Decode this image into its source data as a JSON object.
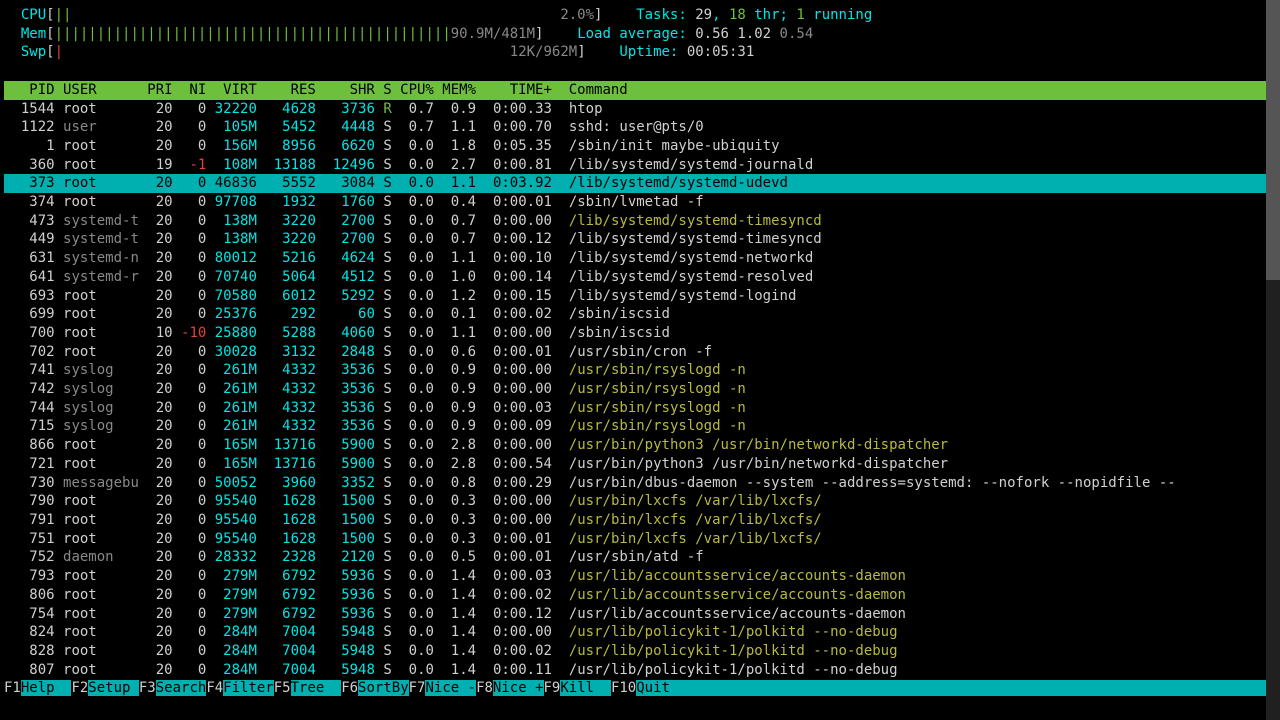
{
  "meters": {
    "cpu": {
      "label": "CPU",
      "bar": "||",
      "pct": "2.0%"
    },
    "mem": {
      "label": "Mem",
      "bar": "|||||||||||||||||||||||||||||||||||||||||||||||",
      "used": "90.9M/481M"
    },
    "swp": {
      "label": "Swp",
      "bar": "|",
      "used": "12K/962M"
    }
  },
  "summary": {
    "tasks_label": "Tasks:",
    "tasks": "29",
    "thr": "18",
    "thr_label": "thr;",
    "running": "1",
    "running_label": "running",
    "load_label": "Load average:",
    "la1": "0.56",
    "la5": "1.02",
    "la15": "0.54",
    "uptime_label": "Uptime:",
    "uptime": "00:05:31"
  },
  "headers": [
    "PID",
    "USER",
    "PRI",
    "NI",
    "VIRT",
    "RES",
    "SHR",
    "S",
    "CPU%",
    "MEM%",
    "TIME+",
    "Command"
  ],
  "processes": [
    {
      "pid": "1544",
      "user": "root",
      "pri": "20",
      "ni": "0",
      "virt": "32220",
      "res": "4628",
      "shr": "3736",
      "s": "R",
      "cpu": "0.7",
      "mem": "0.9",
      "time": "0:00.33",
      "cmd": "htop",
      "cmdhi": false
    },
    {
      "pid": "1122",
      "user": "user",
      "pri": "20",
      "ni": "0",
      "virt": "105M",
      "res": "5452",
      "shr": "4448",
      "s": "S",
      "cpu": "0.7",
      "mem": "1.1",
      "time": "0:00.70",
      "cmd": "sshd: user@pts/0",
      "cmdhi": false
    },
    {
      "pid": "1",
      "user": "root",
      "pri": "20",
      "ni": "0",
      "virt": "156M",
      "res": "8956",
      "shr": "6620",
      "s": "S",
      "cpu": "0.0",
      "mem": "1.8",
      "time": "0:05.35",
      "cmd": "/sbin/init maybe-ubiquity",
      "cmdhi": false
    },
    {
      "pid": "360",
      "user": "root",
      "pri": "19",
      "ni": "-1",
      "virt": "108M",
      "res": "13188",
      "shr": "12496",
      "s": "S",
      "cpu": "0.0",
      "mem": "2.7",
      "time": "0:00.81",
      "cmd": "/lib/systemd/systemd-journald",
      "cmdhi": false,
      "nineg": true
    },
    {
      "pid": "373",
      "user": "root",
      "pri": "20",
      "ni": "0",
      "virt": "46836",
      "res": "5552",
      "shr": "3084",
      "s": "S",
      "cpu": "0.0",
      "mem": "1.1",
      "time": "0:03.92",
      "cmd": "/lib/systemd/systemd-udevd",
      "cmdhi": false,
      "selected": true
    },
    {
      "pid": "374",
      "user": "root",
      "pri": "20",
      "ni": "0",
      "virt": "97708",
      "res": "1932",
      "shr": "1760",
      "s": "S",
      "cpu": "0.0",
      "mem": "0.4",
      "time": "0:00.01",
      "cmd": "/sbin/lvmetad -f",
      "cmdhi": false
    },
    {
      "pid": "473",
      "user": "systemd-t",
      "pri": "20",
      "ni": "0",
      "virt": "138M",
      "res": "3220",
      "shr": "2700",
      "s": "S",
      "cpu": "0.0",
      "mem": "0.7",
      "time": "0:00.00",
      "cmd": "/lib/systemd/systemd-timesyncd",
      "cmdhi": true
    },
    {
      "pid": "449",
      "user": "systemd-t",
      "pri": "20",
      "ni": "0",
      "virt": "138M",
      "res": "3220",
      "shr": "2700",
      "s": "S",
      "cpu": "0.0",
      "mem": "0.7",
      "time": "0:00.12",
      "cmd": "/lib/systemd/systemd-timesyncd",
      "cmdhi": false
    },
    {
      "pid": "631",
      "user": "systemd-n",
      "pri": "20",
      "ni": "0",
      "virt": "80012",
      "res": "5216",
      "shr": "4624",
      "s": "S",
      "cpu": "0.0",
      "mem": "1.1",
      "time": "0:00.10",
      "cmd": "/lib/systemd/systemd-networkd",
      "cmdhi": false
    },
    {
      "pid": "641",
      "user": "systemd-r",
      "pri": "20",
      "ni": "0",
      "virt": "70740",
      "res": "5064",
      "shr": "4512",
      "s": "S",
      "cpu": "0.0",
      "mem": "1.0",
      "time": "0:00.14",
      "cmd": "/lib/systemd/systemd-resolved",
      "cmdhi": false
    },
    {
      "pid": "693",
      "user": "root",
      "pri": "20",
      "ni": "0",
      "virt": "70580",
      "res": "6012",
      "shr": "5292",
      "s": "S",
      "cpu": "0.0",
      "mem": "1.2",
      "time": "0:00.15",
      "cmd": "/lib/systemd/systemd-logind",
      "cmdhi": false
    },
    {
      "pid": "699",
      "user": "root",
      "pri": "20",
      "ni": "0",
      "virt": "25376",
      "res": "292",
      "shr": "60",
      "s": "S",
      "cpu": "0.0",
      "mem": "0.1",
      "time": "0:00.02",
      "cmd": "/sbin/iscsid",
      "cmdhi": false
    },
    {
      "pid": "700",
      "user": "root",
      "pri": "10",
      "ni": "-10",
      "virt": "25880",
      "res": "5288",
      "shr": "4060",
      "s": "S",
      "cpu": "0.0",
      "mem": "1.1",
      "time": "0:00.00",
      "cmd": "/sbin/iscsid",
      "cmdhi": false,
      "nineg": true
    },
    {
      "pid": "702",
      "user": "root",
      "pri": "20",
      "ni": "0",
      "virt": "30028",
      "res": "3132",
      "shr": "2848",
      "s": "S",
      "cpu": "0.0",
      "mem": "0.6",
      "time": "0:00.01",
      "cmd": "/usr/sbin/cron -f",
      "cmdhi": false
    },
    {
      "pid": "741",
      "user": "syslog",
      "pri": "20",
      "ni": "0",
      "virt": "261M",
      "res": "4332",
      "shr": "3536",
      "s": "S",
      "cpu": "0.0",
      "mem": "0.9",
      "time": "0:00.00",
      "cmd": "/usr/sbin/rsyslogd -n",
      "cmdhi": true
    },
    {
      "pid": "742",
      "user": "syslog",
      "pri": "20",
      "ni": "0",
      "virt": "261M",
      "res": "4332",
      "shr": "3536",
      "s": "S",
      "cpu": "0.0",
      "mem": "0.9",
      "time": "0:00.00",
      "cmd": "/usr/sbin/rsyslogd -n",
      "cmdhi": true
    },
    {
      "pid": "744",
      "user": "syslog",
      "pri": "20",
      "ni": "0",
      "virt": "261M",
      "res": "4332",
      "shr": "3536",
      "s": "S",
      "cpu": "0.0",
      "mem": "0.9",
      "time": "0:00.03",
      "cmd": "/usr/sbin/rsyslogd -n",
      "cmdhi": true
    },
    {
      "pid": "715",
      "user": "syslog",
      "pri": "20",
      "ni": "0",
      "virt": "261M",
      "res": "4332",
      "shr": "3536",
      "s": "S",
      "cpu": "0.0",
      "mem": "0.9",
      "time": "0:00.09",
      "cmd": "/usr/sbin/rsyslogd -n",
      "cmdhi": true
    },
    {
      "pid": "866",
      "user": "root",
      "pri": "20",
      "ni": "0",
      "virt": "165M",
      "res": "13716",
      "shr": "5900",
      "s": "S",
      "cpu": "0.0",
      "mem": "2.8",
      "time": "0:00.00",
      "cmd": "/usr/bin/python3 /usr/bin/networkd-dispatcher",
      "cmdhi": true
    },
    {
      "pid": "721",
      "user": "root",
      "pri": "20",
      "ni": "0",
      "virt": "165M",
      "res": "13716",
      "shr": "5900",
      "s": "S",
      "cpu": "0.0",
      "mem": "2.8",
      "time": "0:00.54",
      "cmd": "/usr/bin/python3 /usr/bin/networkd-dispatcher",
      "cmdhi": false
    },
    {
      "pid": "730",
      "user": "messagebu",
      "pri": "20",
      "ni": "0",
      "virt": "50052",
      "res": "3960",
      "shr": "3352",
      "s": "S",
      "cpu": "0.0",
      "mem": "0.8",
      "time": "0:00.29",
      "cmd": "/usr/bin/dbus-daemon --system --address=systemd: --nofork --nopidfile --",
      "cmdhi": false
    },
    {
      "pid": "790",
      "user": "root",
      "pri": "20",
      "ni": "0",
      "virt": "95540",
      "res": "1628",
      "shr": "1500",
      "s": "S",
      "cpu": "0.0",
      "mem": "0.3",
      "time": "0:00.00",
      "cmd": "/usr/bin/lxcfs /var/lib/lxcfs/",
      "cmdhi": true
    },
    {
      "pid": "791",
      "user": "root",
      "pri": "20",
      "ni": "0",
      "virt": "95540",
      "res": "1628",
      "shr": "1500",
      "s": "S",
      "cpu": "0.0",
      "mem": "0.3",
      "time": "0:00.00",
      "cmd": "/usr/bin/lxcfs /var/lib/lxcfs/",
      "cmdhi": true
    },
    {
      "pid": "751",
      "user": "root",
      "pri": "20",
      "ni": "0",
      "virt": "95540",
      "res": "1628",
      "shr": "1500",
      "s": "S",
      "cpu": "0.0",
      "mem": "0.3",
      "time": "0:00.01",
      "cmd": "/usr/bin/lxcfs /var/lib/lxcfs/",
      "cmdhi": true
    },
    {
      "pid": "752",
      "user": "daemon",
      "pri": "20",
      "ni": "0",
      "virt": "28332",
      "res": "2328",
      "shr": "2120",
      "s": "S",
      "cpu": "0.0",
      "mem": "0.5",
      "time": "0:00.01",
      "cmd": "/usr/sbin/atd -f",
      "cmdhi": false
    },
    {
      "pid": "793",
      "user": "root",
      "pri": "20",
      "ni": "0",
      "virt": "279M",
      "res": "6792",
      "shr": "5936",
      "s": "S",
      "cpu": "0.0",
      "mem": "1.4",
      "time": "0:00.03",
      "cmd": "/usr/lib/accountsservice/accounts-daemon",
      "cmdhi": true
    },
    {
      "pid": "806",
      "user": "root",
      "pri": "20",
      "ni": "0",
      "virt": "279M",
      "res": "6792",
      "shr": "5936",
      "s": "S",
      "cpu": "0.0",
      "mem": "1.4",
      "time": "0:00.02",
      "cmd": "/usr/lib/accountsservice/accounts-daemon",
      "cmdhi": true
    },
    {
      "pid": "754",
      "user": "root",
      "pri": "20",
      "ni": "0",
      "virt": "279M",
      "res": "6792",
      "shr": "5936",
      "s": "S",
      "cpu": "0.0",
      "mem": "1.4",
      "time": "0:00.12",
      "cmd": "/usr/lib/accountsservice/accounts-daemon",
      "cmdhi": false
    },
    {
      "pid": "824",
      "user": "root",
      "pri": "20",
      "ni": "0",
      "virt": "284M",
      "res": "7004",
      "shr": "5948",
      "s": "S",
      "cpu": "0.0",
      "mem": "1.4",
      "time": "0:00.00",
      "cmd": "/usr/lib/policykit-1/polkitd --no-debug",
      "cmdhi": true
    },
    {
      "pid": "828",
      "user": "root",
      "pri": "20",
      "ni": "0",
      "virt": "284M",
      "res": "7004",
      "shr": "5948",
      "s": "S",
      "cpu": "0.0",
      "mem": "1.4",
      "time": "0:00.02",
      "cmd": "/usr/lib/policykit-1/polkitd --no-debug",
      "cmdhi": true
    },
    {
      "pid": "807",
      "user": "root",
      "pri": "20",
      "ni": "0",
      "virt": "284M",
      "res": "7004",
      "shr": "5948",
      "s": "S",
      "cpu": "0.0",
      "mem": "1.4",
      "time": "0:00.11",
      "cmd": "/usr/lib/policykit-1/polkitd --no-debug",
      "cmdhi": false
    }
  ],
  "fnkeys": [
    {
      "k": "F1",
      "l": "Help  "
    },
    {
      "k": "F2",
      "l": "Setup "
    },
    {
      "k": "F3",
      "l": "Search"
    },
    {
      "k": "F4",
      "l": "Filter"
    },
    {
      "k": "F5",
      "l": "Tree  "
    },
    {
      "k": "F6",
      "l": "SortBy"
    },
    {
      "k": "F7",
      "l": "Nice -"
    },
    {
      "k": "F8",
      "l": "Nice +"
    },
    {
      "k": "F9",
      "l": "Kill  "
    },
    {
      "k": "F10",
      "l": "Quit  "
    }
  ]
}
